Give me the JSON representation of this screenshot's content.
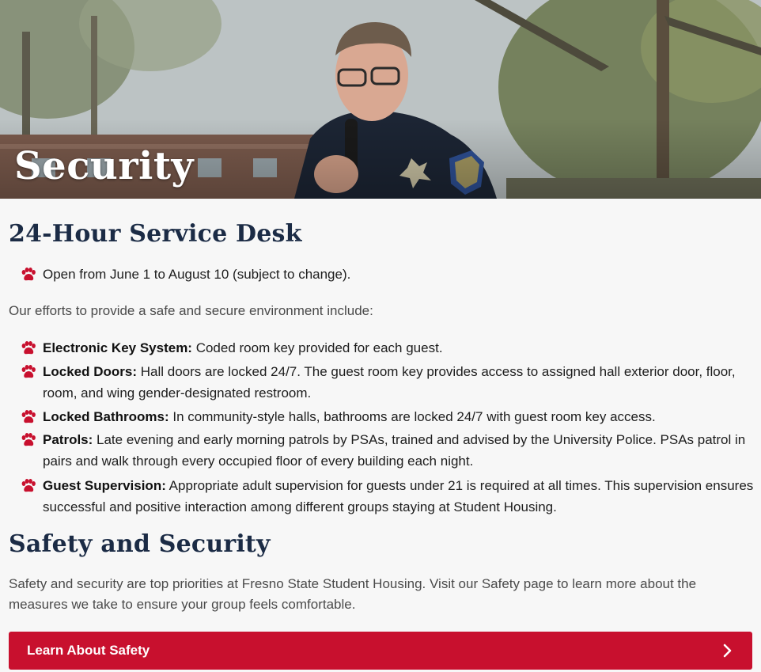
{
  "hero": {
    "title": "Security"
  },
  "service_desk": {
    "heading": "24-Hour Service Desk",
    "items": [
      {
        "bold": "",
        "text": "Open from June 1 to August 10 (subject to change)."
      }
    ]
  },
  "efforts": {
    "intro": "Our efforts to provide a safe and secure environment include:",
    "items": [
      {
        "bold": "Electronic Key System:",
        "text": " Coded room key provided for each guest."
      },
      {
        "bold": "Locked Doors:",
        "text": " Hall doors are locked 24/7. The guest room key provides access to assigned hall exterior door, floor, room, and wing gender-designated restroom."
      },
      {
        "bold": "Locked Bathrooms:",
        "text": " In community-style halls, bathrooms are locked 24/7 with guest room key access."
      },
      {
        "bold": "Patrols:",
        "text": " Late evening and early morning patrols by PSAs, trained and advised by the University Police. PSAs patrol in pairs and walk through every occupied floor of every building each night."
      },
      {
        "bold": "Guest Supervision:",
        "text": " Appropriate adult supervision for guests under 21 is required at all times. This supervision ensures successful and positive interaction among different groups staying at Student Housing."
      }
    ]
  },
  "safety": {
    "heading": "Safety and Security",
    "paragraph": "Safety and security are top priorities at Fresno State Student Housing. Visit our Safety page to learn more about the measures we take to ensure your group feels comfortable.",
    "button_label": "Learn About Safety"
  },
  "icons": {
    "bullet": "paw-print-icon",
    "button_arrow": "chevron-right-icon"
  },
  "colors": {
    "heading": "#1b2b45",
    "accent": "#c8102e",
    "background": "#f7f7f7"
  }
}
